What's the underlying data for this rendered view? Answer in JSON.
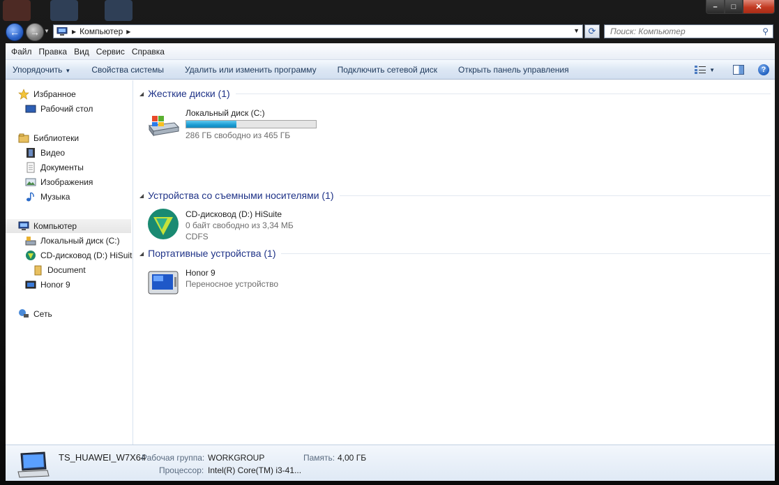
{
  "window": {
    "controls": {
      "minimize": "–",
      "maximize": "□",
      "close": "✕"
    }
  },
  "address": {
    "crumbs": [
      "Компьютер"
    ],
    "search_placeholder": "Поиск: Компьютер"
  },
  "menubar": [
    "Файл",
    "Правка",
    "Вид",
    "Сервис",
    "Справка"
  ],
  "commandbar": {
    "organize": "Упорядочить",
    "system_properties": "Свойства системы",
    "uninstall": "Удалить или изменить программу",
    "map_drive": "Подключить сетевой диск",
    "control_panel": "Открыть панель управления"
  },
  "navpane": {
    "favorites": "Избранное",
    "desktop": "Рабочий стол",
    "libraries": "Библиотеки",
    "video": "Видео",
    "documents": "Документы",
    "images": "Изображения",
    "music": "Музыка",
    "computer": "Компьютер",
    "local_disk": "Локальный диск (C:)",
    "cd_drive": "CD-дисковод (D:) HiSuite",
    "document": "Document",
    "honor": "Honor 9",
    "network": "Сеть"
  },
  "groups": {
    "hard_disks": "Жесткие диски (1)",
    "removable": "Устройства со съемными носителями (1)",
    "portable": "Портативные устройства (1)"
  },
  "items": {
    "local_disk": {
      "name": "Локальный диск (C:)",
      "free": "286 ГБ свободно из 465 ГБ",
      "used_fraction": 0.385
    },
    "cd_drive": {
      "name": "CD-дисковод (D:) HiSuite",
      "free": "0 байт свободно из 3,34 МБ",
      "fs": "CDFS"
    },
    "honor": {
      "name": "Honor 9",
      "type": "Переносное устройство"
    }
  },
  "details": {
    "computer_name": "TS_HUAWEI_W7X64",
    "workgroup_label": "Рабочая группа:",
    "workgroup": "WORKGROUP",
    "memory_label": "Память:",
    "memory": "4,00 ГБ",
    "cpu_label": "Процессор:",
    "cpu": "Intel(R) Core(TM) i3-41..."
  },
  "colors": {
    "accent": "#1e3287",
    "bar_fill": "#1a9bd2"
  }
}
